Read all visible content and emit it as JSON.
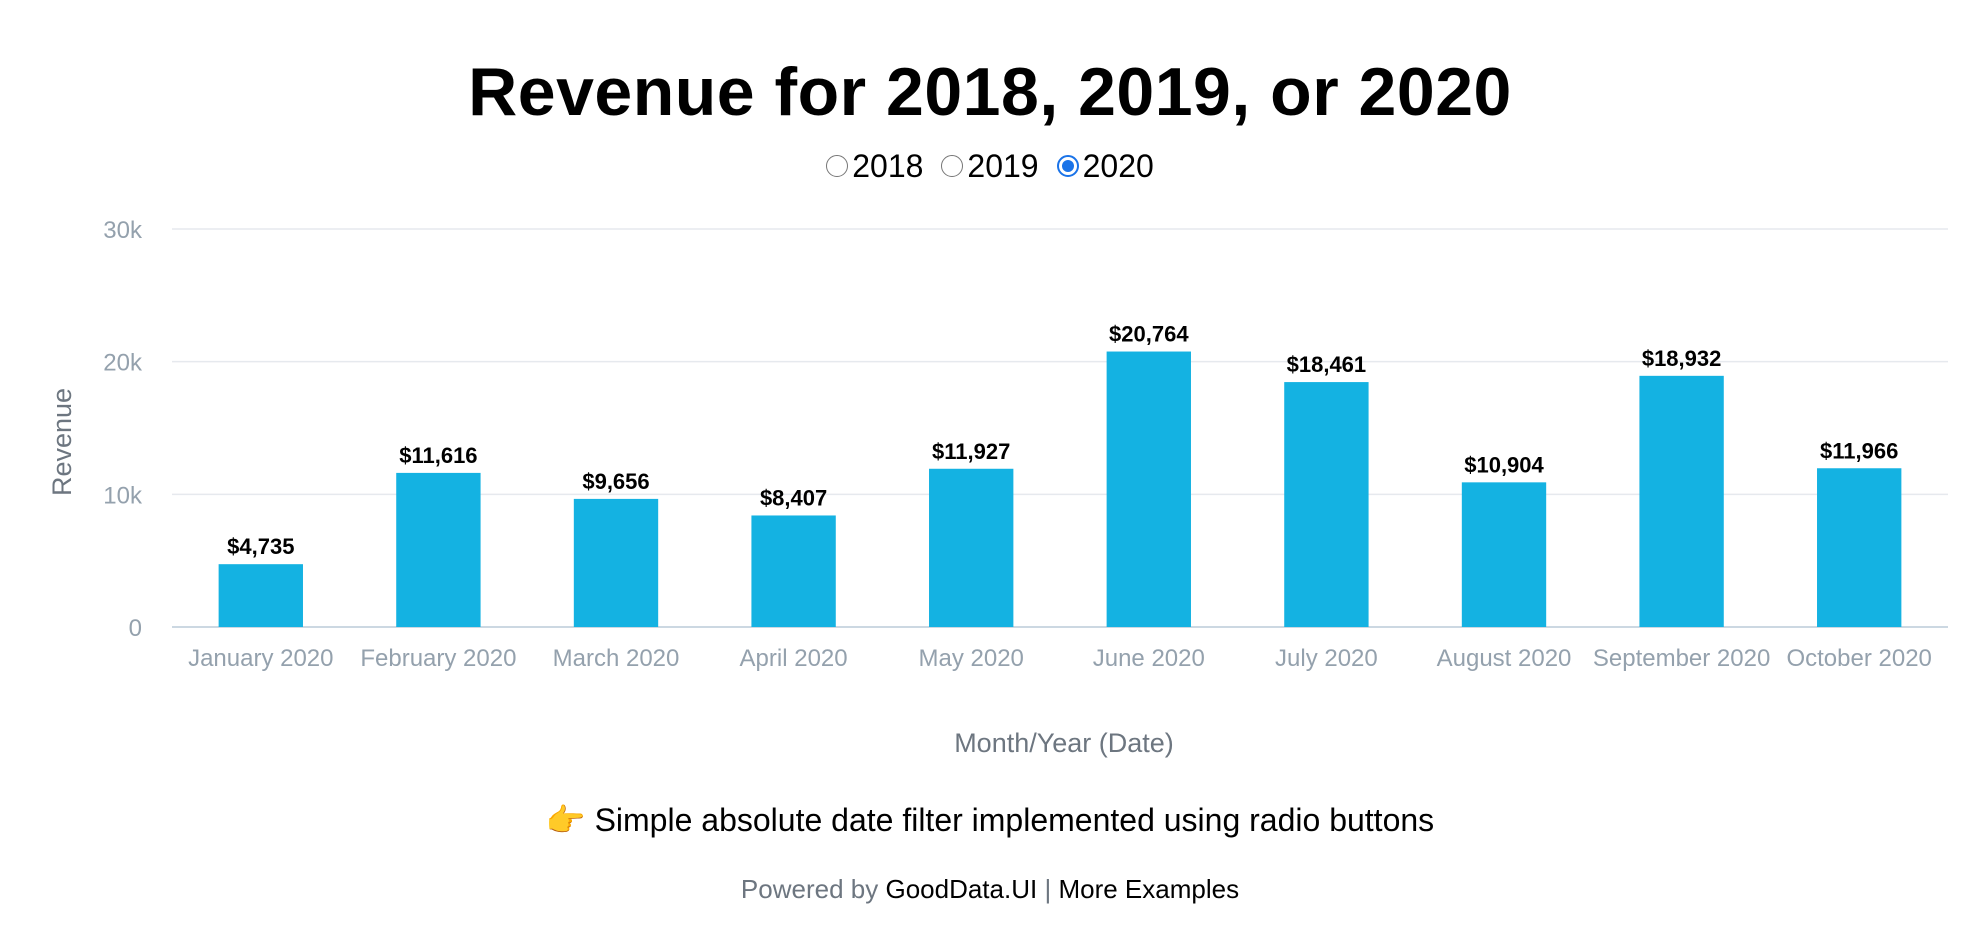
{
  "page": {
    "title": "Revenue for 2018, 2019, or 2020",
    "tip_icon": "👉",
    "tip_text": "Simple absolute date filter implemented using radio buttons",
    "footer": {
      "powered_by": "Powered by",
      "brand_link": "GoodData.UI",
      "separator": "|",
      "more_link": "More Examples"
    }
  },
  "filter": {
    "options": [
      "2018",
      "2019",
      "2020"
    ],
    "selected": "2020",
    "accent_color": "#1a73e8"
  },
  "chart_data": {
    "type": "bar",
    "title": "",
    "xlabel": "Month/Year (Date)",
    "ylabel": "Revenue",
    "ylim": [
      0,
      30000
    ],
    "yticks": [
      0,
      10000,
      20000,
      30000
    ],
    "ytick_labels": [
      "0",
      "10k",
      "20k",
      "30k"
    ],
    "grid": true,
    "bar_color": "#14b2e2",
    "categories": [
      "January 2020",
      "February 2020",
      "March 2020",
      "April 2020",
      "May 2020",
      "June 2020",
      "July 2020",
      "August 2020",
      "September 2020",
      "October 2020"
    ],
    "values": [
      4735,
      11616,
      9656,
      8407,
      11927,
      20764,
      18461,
      10904,
      18932,
      11966
    ],
    "data_labels": [
      "$4,735",
      "$11,616",
      "$9,656",
      "$8,407",
      "$11,927",
      "$20,764",
      "$18,461",
      "$10,904",
      "$18,932",
      "$11,966"
    ]
  }
}
